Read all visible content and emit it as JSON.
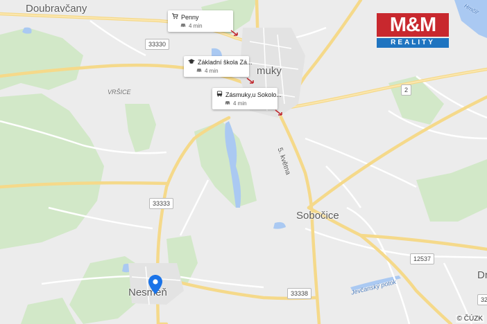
{
  "map": {
    "towns": [
      {
        "id": "doubravcany",
        "label": "Doubravčany"
      },
      {
        "id": "zasmuky",
        "label": "muky"
      },
      {
        "id": "sobocice",
        "label": "Sobočice"
      },
      {
        "id": "nesmen",
        "label": "Nesměň"
      },
      {
        "id": "dr",
        "label": "Dr"
      }
    ],
    "localities": [
      {
        "id": "vrsice",
        "label": "VRŠICE"
      }
    ],
    "roads": [
      {
        "id": "r33330",
        "label": "33330"
      },
      {
        "id": "r2",
        "label": "2"
      },
      {
        "id": "r33333",
        "label": "33333"
      },
      {
        "id": "r12537",
        "label": "12537"
      },
      {
        "id": "r33338",
        "label": "33338"
      },
      {
        "id": "r32",
        "label": "32"
      }
    ],
    "street_label": "5. května",
    "stream_label": "Jevčanský potok",
    "water_label": "Hrnčíř",
    "copyright": "© ČÚZK"
  },
  "pois": [
    {
      "title": "Penny",
      "time": "4 min",
      "icon": "shopping-cart-icon"
    },
    {
      "title": "Základní škola Zá...",
      "time": "4 min",
      "icon": "school-icon"
    },
    {
      "title": "Zásmuky,u Sokolo...",
      "time": "4 min",
      "icon": "bus-icon"
    }
  ],
  "logo": {
    "top": "M&M",
    "bottom": "REALITY",
    "top_color": "#c8282e",
    "bottom_color": "#1f74c0"
  },
  "colors": {
    "road": "#f9dc8e",
    "road_minor": "#ffffff",
    "forest": "#cfe7c4",
    "water": "#a8c8f0",
    "land": "#ececec",
    "pin": "#1a73e8"
  }
}
